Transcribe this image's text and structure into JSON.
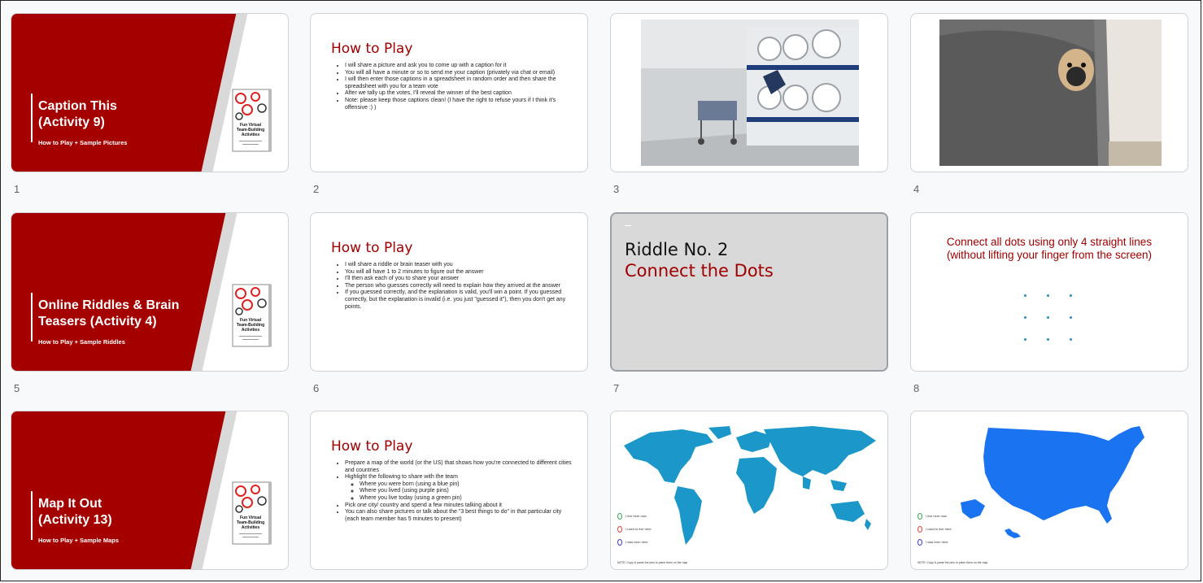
{
  "slides": [
    {
      "number": "1",
      "title": "Caption This\n(Activity 9)",
      "subtitle": "How to Play + Sample Pictures",
      "book_title": "Fun Virtual Team-Building Activities"
    },
    {
      "number": "2",
      "title": "How to Play",
      "items": [
        "I will share a picture and ask you to come up with a caption for it",
        "You will all have a minute or so to send me your caption (privately via chat or email)",
        "I will then enter those captions in a spreadsheet in random order and then share the spreadsheet with you for a team vote",
        "After we tally up the votes, I'll reveal the winner of the best caption",
        "Note: please keep those captions clean! (I have the right to refuse yours if I think it's offensive :) )"
      ]
    },
    {
      "number": "3"
    },
    {
      "number": "4"
    },
    {
      "number": "5",
      "title": "Online Riddles & Brain\nTeasers (Activity 4)",
      "subtitle": "How to Play + Sample Riddles",
      "book_title": "Fun Virtual Team-Building Activities"
    },
    {
      "number": "6",
      "title": "How to Play",
      "items": [
        "I will share a riddle or brain teaser with you",
        "You will all have 1 to 2 minutes to figure out the answer",
        "I'll then ask each of you to share your answer",
        "The person who guesses correctly will need to explain how they arrived at the answer",
        "If you guessed correctly, and the explanation is valid, you'll win a point. If you guessed correctly, but the explanation is invalid (i.e. you just \"guessed it\"), then you don't get any points."
      ]
    },
    {
      "number": "7",
      "line1": "Riddle No. 2",
      "line2": "Connect the Dots"
    },
    {
      "number": "8",
      "title": "Connect all dots using only 4 straight lines\n(without lifting your finger from the screen)"
    },
    {
      "number": "9",
      "title": "Map It Out\n (Activity 13)",
      "subtitle": "How to Play + Sample Maps",
      "book_title": "Fun Virtual Team-Building Activities"
    },
    {
      "number": "10",
      "title": "How to Play",
      "items": [
        "Prepare a map of the world (or the US) that shows how you're connected to different cities and countries",
        "Highlight the following to share with the team",
        "Pick one city/ country and spend a few minutes talking about it",
        "You can also share pictures or talk about the \"3 best things to do\" in that particular city (each team member has 5 minutes to present)"
      ],
      "subitems": [
        "Where you were born (using a blue pin)",
        "Where you lived (using purple pins)",
        "Where you live today (using a green pin)"
      ]
    },
    {
      "number": "11",
      "legend": [
        "I live here now",
        "I used to live here",
        "I was born here"
      ],
      "note": "NOTE: Copy & paste the pins to place them on the map"
    },
    {
      "number": "12",
      "legend": [
        "I live here now",
        "I used to live here",
        "I was born here"
      ],
      "note": "NOTE: Copy & paste the pins to place them on the map"
    }
  ],
  "colors": {
    "brand_red": "#a00000",
    "map_world": "#1b97c9",
    "map_us": "#1a73f0"
  }
}
